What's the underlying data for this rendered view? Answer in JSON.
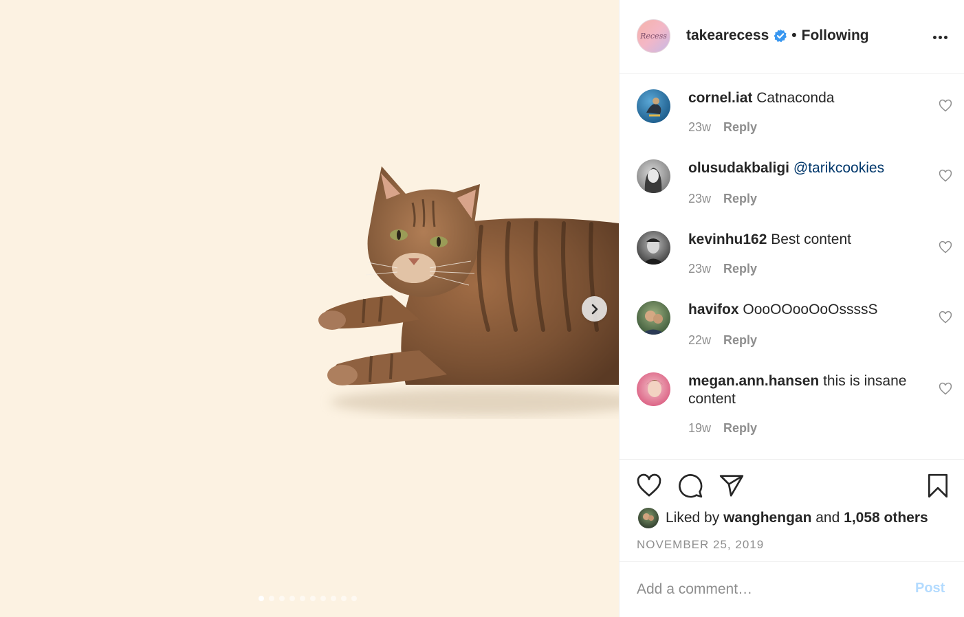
{
  "post": {
    "carousel": {
      "slide_count": 10,
      "active_index": 0,
      "next_icon": "chevron-right-icon"
    },
    "image_subject": "tabby cat lying down"
  },
  "header": {
    "avatar_text": "Recess",
    "username": "takearecess",
    "verified_icon": "verified-badge-icon",
    "separator": "•",
    "follow_status": "Following",
    "more_icon": "more-options-icon"
  },
  "comments": [
    {
      "username": "cornel.iat",
      "text": "Catnaconda",
      "mention": "",
      "time": "23w",
      "reply": "Reply"
    },
    {
      "username": "olusudakbaligi",
      "text": "",
      "mention": "@tarikcookies",
      "time": "23w",
      "reply": "Reply"
    },
    {
      "username": "kevinhu162",
      "text": "Best content",
      "mention": "",
      "time": "23w",
      "reply": "Reply"
    },
    {
      "username": "havifox",
      "text": "OooOOooOoOssssS",
      "mention": "",
      "time": "22w",
      "reply": "Reply"
    },
    {
      "username": "megan.ann.hansen",
      "text": "this is insane content",
      "mention": "",
      "time": "19w",
      "reply": "Reply"
    }
  ],
  "actions": {
    "like_icon": "heart-icon",
    "comment_icon": "comment-bubble-icon",
    "share_icon": "paper-plane-icon",
    "save_icon": "bookmark-icon"
  },
  "likes": {
    "prefix": "Liked by",
    "user": "wanghengan",
    "conjunction": "and",
    "others": "1,058 others"
  },
  "date": "NOVEMBER 25, 2019",
  "add_comment": {
    "placeholder": "Add a comment…",
    "post_label": "Post"
  },
  "colors": {
    "media_background": "#fcf2e2",
    "link": "#00376b",
    "verified": "#3897f0",
    "muted": "#8e8e8e",
    "post_disabled": "#b3dbff"
  }
}
